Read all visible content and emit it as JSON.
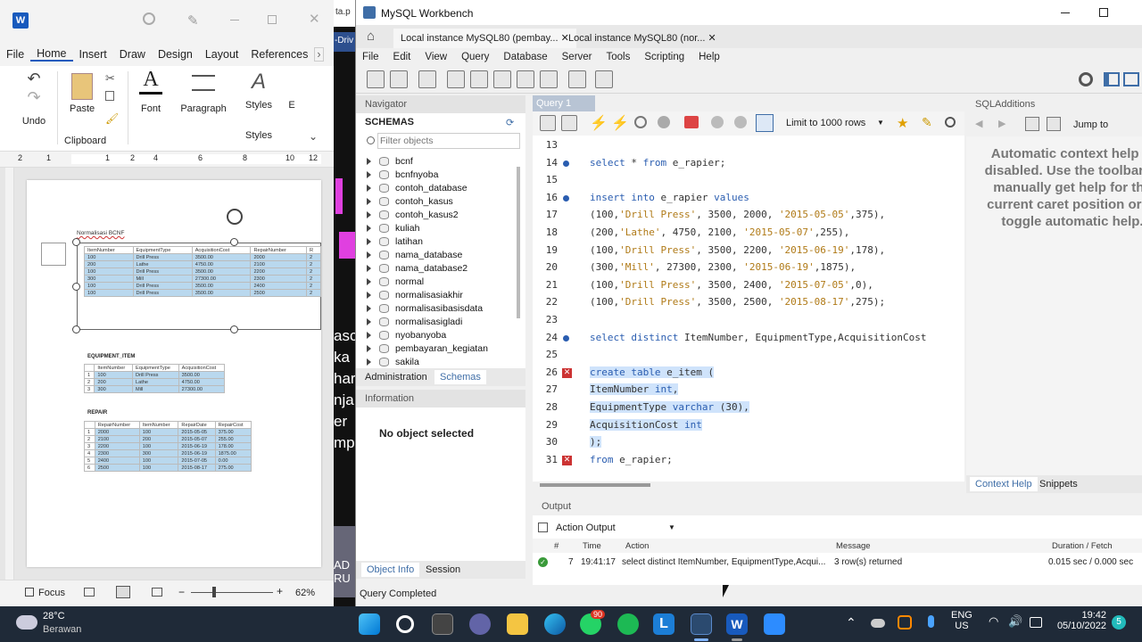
{
  "word": {
    "menu": [
      "File",
      "Home",
      "Insert",
      "Draw",
      "Design",
      "Layout",
      "References"
    ],
    "active_menu": "Home",
    "ribbon": {
      "undo_label": "Undo",
      "paste_label": "Paste",
      "clipboard_label": "Clipboard",
      "font_label": "Font",
      "paragraph_label": "Paragraph",
      "styles_label": "Styles",
      "styles_group_label": "Styles",
      "editing_label": "E"
    },
    "ruler_marks": [
      "2",
      "1",
      "1",
      "2",
      "4",
      "6",
      "8",
      "10",
      "12"
    ],
    "doc": {
      "heading": "Normalisasi BCNF",
      "main_table": {
        "headers": [
          "ItemNumber",
          "EquipmentType",
          "AcquisitionCost",
          "RepairNumber",
          "R"
        ],
        "rows": [
          [
            "100",
            "Drill Press",
            "3500.00",
            "2000",
            "2"
          ],
          [
            "200",
            "Lathe",
            "4750.00",
            "2100",
            "2"
          ],
          [
            "100",
            "Drill Press",
            "3500.00",
            "2200",
            "2"
          ],
          [
            "300",
            "Mill",
            "27300.00",
            "2300",
            "2"
          ],
          [
            "100",
            "Drill Press",
            "3500.00",
            "2400",
            "2"
          ],
          [
            "100",
            "Drill Press",
            "3500.00",
            "2500",
            "2"
          ]
        ]
      },
      "equipment_title": "EQUIPMENT_ITEM",
      "equipment_table": {
        "headers": [
          "",
          "ItemNumber",
          "EquipmentType",
          "AcquisitionCost"
        ],
        "rows": [
          [
            "1",
            "100",
            "Drill Press",
            "3500.00"
          ],
          [
            "2",
            "200",
            "Lathe",
            "4750.00"
          ],
          [
            "3",
            "300",
            "Mill",
            "27300.00"
          ]
        ]
      },
      "repair_title": "REPAIR",
      "repair_table": {
        "headers": [
          "",
          "RepairNumber",
          "ItemNumber",
          "RepairDate",
          "RepairCost"
        ],
        "rows": [
          [
            "1",
            "2000",
            "100",
            "2015-05-05",
            "375.00"
          ],
          [
            "2",
            "2100",
            "200",
            "2015-05-07",
            "255.00"
          ],
          [
            "3",
            "2200",
            "100",
            "2015-06-19",
            "178.00"
          ],
          [
            "4",
            "2300",
            "300",
            "2015-06-19",
            "1875.00"
          ],
          [
            "5",
            "2400",
            "100",
            "2015-07-05",
            "0.00"
          ],
          [
            "6",
            "2500",
            "100",
            "2015-08-17",
            "275.00"
          ]
        ]
      }
    },
    "status": {
      "focus_label": "Focus",
      "zoom": "62%"
    }
  },
  "background_strip_text": [
    "ta.p",
    "-Driv",
    "asc",
    "ka",
    "har",
    "nja",
    "er",
    "mp",
    "AD",
    "RU"
  ],
  "mysql": {
    "title": "MySQL Workbench",
    "tabs": [
      "Local instance MySQL80 (pembay...",
      "Local instance MySQL80 (nor..."
    ],
    "menu": [
      "File",
      "Edit",
      "View",
      "Query",
      "Database",
      "Server",
      "Tools",
      "Scripting",
      "Help"
    ],
    "navigator": {
      "header": "Navigator",
      "schemas_label": "SCHEMAS",
      "filter_placeholder": "Filter objects",
      "schemas": [
        "bcnf",
        "bcnfnyoba",
        "contoh_database",
        "contoh_kasus",
        "contoh_kasus2",
        "kuliah",
        "latihan",
        "nama_database",
        "nama_database2",
        "normal",
        "normalisasiakhir",
        "normalisasibasisdata",
        "normalisasigladi",
        "nyobanyoba",
        "pembayaran_kegiatan",
        "sakila"
      ],
      "tab_admin": "Administration",
      "tab_schemas": "Schemas",
      "info_header": "Information",
      "no_object": "No object selected",
      "tab_object_info": "Object Info",
      "tab_session": "Session"
    },
    "query_tab": "Query 1",
    "limit_label": "Limit to 1000 rows",
    "code_lines": [
      {
        "n": "13",
        "t": ""
      },
      {
        "n": "14",
        "t": "select * from e_rapier;"
      },
      {
        "n": "15",
        "t": ""
      },
      {
        "n": "16",
        "t": "insert into e_rapier values"
      },
      {
        "n": "17",
        "t": "(100,'Drill Press', 3500, 2000, '2015-05-05',375),"
      },
      {
        "n": "18",
        "t": "(200,'Lathe', 4750, 2100, '2015-05-07',255),"
      },
      {
        "n": "19",
        "t": "(100,'Drill Press', 3500, 2200, '2015-06-19',178),"
      },
      {
        "n": "20",
        "t": "(300,'Mill', 27300, 2300, '2015-06-19',1875),"
      },
      {
        "n": "21",
        "t": "(100,'Drill Press', 3500, 2400, '2015-07-05',0),"
      },
      {
        "n": "22",
        "t": "(100,'Drill Press', 3500, 2500, '2015-08-17',275);"
      },
      {
        "n": "23",
        "t": ""
      },
      {
        "n": "24",
        "t": "select distinct ItemNumber, EquipmentType,AcquisitionCost"
      },
      {
        "n": "25",
        "t": ""
      },
      {
        "n": "26",
        "t": "create table e_item ("
      },
      {
        "n": "27",
        "t": "ItemNumber int,"
      },
      {
        "n": "28",
        "t": "EquipmentType varchar (30),"
      },
      {
        "n": "29",
        "t": "AcquisitionCost int"
      },
      {
        "n": "30",
        "t": ");"
      },
      {
        "n": "31",
        "t": "from e_rapier;"
      }
    ],
    "sqladditions": {
      "header": "SQLAdditions",
      "jump_to": "Jump to",
      "help_text": "Automatic context help is disabled. Use the toolbar to manually get help for the current caret position or to toggle automatic help.",
      "tab_context": "Context Help",
      "tab_snippets": "Snippets"
    },
    "output": {
      "header": "Output",
      "select_value": "Action Output",
      "columns": [
        "#",
        "Time",
        "Action",
        "Message",
        "Duration / Fetch"
      ],
      "rows": [
        {
          "n": "7",
          "time": "19:41:17",
          "action": "select distinct ItemNumber, EquipmentType,Acqui...",
          "message": "3 row(s) returned",
          "duration": "0.015 sec / 0.000 sec"
        }
      ]
    },
    "status": "Query Completed"
  },
  "taskbar": {
    "temp": "28°C",
    "weather": "Berawan",
    "lang1": "ENG",
    "lang2": "US",
    "time": "19:42",
    "date": "05/10/2022",
    "whatsapp_badge": "90",
    "notif_count": "5"
  }
}
